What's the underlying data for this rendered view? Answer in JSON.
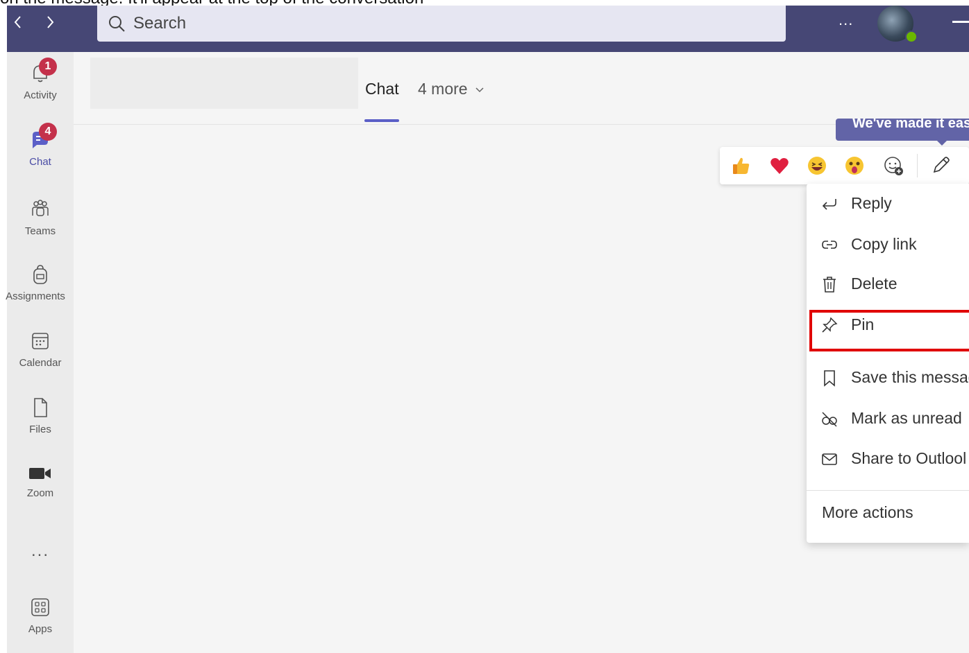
{
  "caption": "on the message. It'll appear at the top of the conversation",
  "topbar": {
    "search_placeholder": "Search",
    "more_label": "...",
    "back_icon": "chevron-left-icon",
    "forward_icon": "chevron-right-icon"
  },
  "rail": {
    "items": [
      {
        "label": "Activity",
        "icon": "bell-icon",
        "badge": "1"
      },
      {
        "label": "Chat",
        "icon": "chat-icon",
        "badge": "4"
      },
      {
        "label": "Teams",
        "icon": "teams-icon"
      },
      {
        "label": "Assignments",
        "icon": "backpack-icon"
      },
      {
        "label": "Calendar",
        "icon": "calendar-icon"
      },
      {
        "label": "Files",
        "icon": "file-icon"
      },
      {
        "label": "Zoom",
        "icon": "video-camera-icon"
      },
      {
        "label": "...",
        "icon": "more-icon"
      },
      {
        "label": "Apps",
        "icon": "apps-icon"
      }
    ]
  },
  "header": {
    "tab_chat": "Chat",
    "tab_more": "4 more"
  },
  "tooltip": {
    "text": "We've made it easi"
  },
  "reactions": [
    "thumbs-up-icon",
    "heart-icon",
    "laugh-icon",
    "surprised-icon",
    "add-reaction-icon",
    "edit-pencil-icon"
  ],
  "context_menu": {
    "items": [
      {
        "label": "Reply",
        "icon": "reply-icon"
      },
      {
        "label": "Copy link",
        "icon": "link-icon"
      },
      {
        "label": "Delete",
        "icon": "trash-icon"
      },
      {
        "label": "Pin",
        "icon": "pin-icon",
        "highlighted": true
      },
      {
        "label": "Save this messag",
        "icon": "bookmark-icon"
      },
      {
        "label": "Mark as unread",
        "icon": "unread-eye-icon"
      },
      {
        "label": "Share to Outlool",
        "icon": "mail-icon"
      }
    ],
    "more_actions": "More actions"
  },
  "colors": {
    "topbar": "#464775",
    "accent": "#5b5fc7",
    "badge": "#c4314b",
    "highlight_box": "#e00000"
  }
}
